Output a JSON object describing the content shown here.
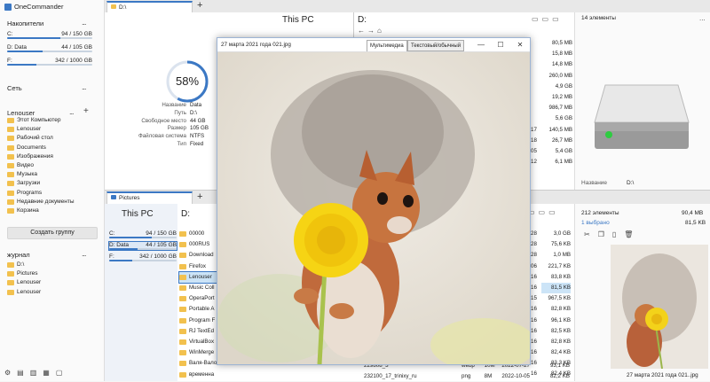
{
  "app": {
    "title": "OneCommander"
  },
  "sidebar": {
    "drives_title": "Накопители",
    "drives": [
      {
        "letter": "C:",
        "name": "",
        "used": "94 / 150 GB",
        "fill": 0.63
      },
      {
        "letter": "D:",
        "name": "Data",
        "used": "44 / 105 GB",
        "fill": 0.42
      },
      {
        "letter": "F:",
        "name": "",
        "used": "342 / 1000 GB",
        "fill": 0.34
      }
    ],
    "network_title": "Сеть",
    "user_title": "Lenouser",
    "user_items": [
      "Этот Компьютер",
      "Lenouser",
      "Рабочий стол",
      "Documents",
      "Изображения",
      "Видео",
      "Музыка",
      "Загрузки",
      "Programs",
      "Недавние документы",
      "Корзина"
    ],
    "create_group": "Создать группу",
    "journal_title": "журнал",
    "journal_items": [
      "D:\\",
      "Pictures",
      "Lenouser",
      "Lenouser"
    ],
    "more": "...",
    "plus": "+"
  },
  "top_panel": {
    "tab": "D:\\",
    "plus": "+",
    "this_pc": "This PC",
    "percent": "58%",
    "percent_value": 0.58,
    "props": [
      {
        "k": "Название",
        "v": "Data"
      },
      {
        "k": "Путь",
        "v": "D:\\"
      },
      {
        "k": "Свободное место",
        "v": "44 GB"
      },
      {
        "k": "Размер",
        "v": "105 GB"
      },
      {
        "k": "Файловая система",
        "v": "NTFS"
      },
      {
        "k": "Тип",
        "v": "Fixed"
      }
    ],
    "path": "D:",
    "sizes": [
      "80,5 MB",
      "15,8 MB",
      "14,8 MB",
      "260,0 MB",
      "4,9 GB",
      "19,2 MB",
      "986,7 MB",
      "5,6 GB",
      "140,5 MB",
      "26,7 MB",
      "5,4 GB",
      "6,1 MB"
    ],
    "dates": [
      "",
      "",
      "",
      "",
      "",
      "",
      "",
      "",
      "17",
      "18",
      "05",
      "12",
      "05"
    ],
    "info_count": "14 элементы",
    "info_name_label": "Название",
    "info_name_value": "D:\\"
  },
  "bottom_panel": {
    "tab": "Pictures",
    "plus": "+",
    "this_pc": "This PC",
    "drives": [
      {
        "letter": "C:",
        "name": "",
        "used": "94 / 150 GB",
        "fill": 0.63
      },
      {
        "letter": "D:",
        "name": "Data",
        "used": "44 / 105 GB",
        "fill": 0.42
      },
      {
        "letter": "F:",
        "name": "",
        "used": "342 / 1000 GB",
        "fill": 0.34
      }
    ],
    "path": "D:",
    "folders": [
      "00000",
      "000RUS",
      "Download",
      "Firefox",
      "Lenouser",
      "Music Coll",
      "OperaPort",
      "Portable A",
      "Program F",
      "RJ TextEd",
      "VirtualBox",
      "WinMerge",
      "Валя-Вало",
      "временна"
    ],
    "days": [
      "28",
      "28",
      "28",
      "06",
      "16",
      "16",
      "15",
      "16",
      "16",
      "16",
      "16",
      "16",
      "16",
      "16"
    ],
    "sizes": [
      "3,0 GB",
      "75,6 KB",
      "1,0 MB",
      "221,7 KB",
      "83,8 KB",
      "81,5 KB",
      "967,5 KB",
      "82,8 KB",
      "96,1 KB",
      "82,5 KB",
      "82,8 KB",
      "82,4 KB",
      "83,3 KB",
      "82,4 KB"
    ],
    "file_rows": [
      {
        "name": "229808_3",
        "ext": "webp",
        "size": "10M",
        "date": "2022-07-27",
        "kb": "93,1 KB"
      },
      {
        "name": "232100_17_trinixy_ru",
        "ext": "png",
        "size": "8M",
        "date": "2022-10-05",
        "kb": "82,2 KB"
      }
    ],
    "info_count": "212 элементы",
    "info_total": "90,4 MB",
    "info_selected": "1 выбрано",
    "info_sel_size": "81,5 KB",
    "preview_caption": "27 марта 2021 года 021..jpg"
  },
  "viewer": {
    "title": "27 марта 2021 года 021.jpg",
    "tab_media": "Мультимедиа",
    "tab_text": "Текстовый/обычный",
    "min": "—",
    "max": "☐",
    "close": "✕"
  },
  "colors": {
    "accent": "#3b78c4",
    "folder": "#f2c14e",
    "selection": "#cce4f7"
  }
}
